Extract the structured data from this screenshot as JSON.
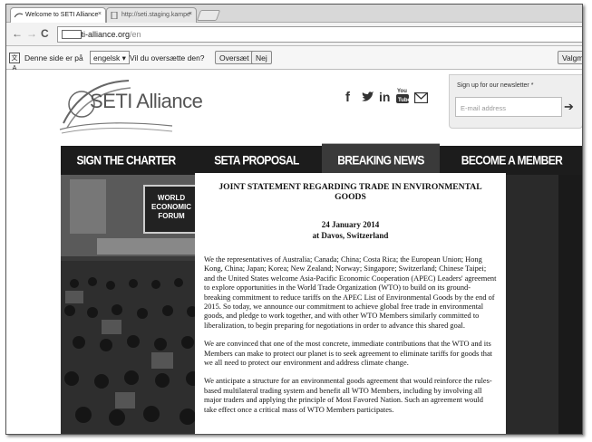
{
  "browser": {
    "tabs": [
      {
        "title": "Welcome to SETI Alliance",
        "close": "×"
      },
      {
        "title": "http://seti.staging.kampe",
        "close": "×"
      }
    ],
    "address": {
      "domain": "seti-alliance.org",
      "path": "/en"
    }
  },
  "translate_bar": {
    "prefix": "Denne side er på",
    "language": "engelsk",
    "question": "Vil du oversætte den?",
    "translate_button": "Oversæt",
    "no_button": "Nej",
    "options_button": "Valgmu"
  },
  "site": {
    "logo_text": "SETI Alliance",
    "newsletter_label": "Sign up for our newsletter *",
    "email_placeholder": "E-mail address",
    "nav": [
      "SIGN THE CHARTER",
      "SETA PROPOSAL",
      "BREAKING NEWS",
      "BECOME A MEMBER"
    ],
    "active_nav": "BREAKING NEWS",
    "photo_sign": [
      "WORLD",
      "ECONOMIC",
      "FORUM"
    ]
  },
  "article": {
    "title": "JOINT STATEMENT REGARDING TRADE IN ENVIRONMENTAL GOODS",
    "date": "24 January 2014",
    "place": "at Davos, Switzerland",
    "paragraphs": [
      "We the representatives of Australia; Canada; China; Costa Rica; the European Union; Hong Kong, China; Japan; Korea; New Zealand; Norway; Singapore; Switzerland; Chinese Taipei; and the United States welcome Asia-Pacific Economic Cooperation (APEC) Leaders' agreement to explore opportunities in the World Trade Organization (WTO) to build on its ground-breaking commitment to reduce tariffs on the APEC List of Environmental Goods by the end of 2015.  So today, we announce our commitment to achieve global free trade in environmental goods, and pledge to work together, and with other WTO Members similarly committed to liberalization, to begin preparing for negotiations in order to advance this shared goal.",
      "We are convinced that one of the most concrete, immediate contributions that the WTO and its Members can make to protect our planet is to seek agreement to eliminate tariffs for goods that we all need to protect our environment and address climate change.",
      "We anticipate a structure for an environmental goods agreement that would reinforce the rules-based multilateral trading system and benefit all WTO Members, including by involving all major traders and applying the principle of Most Favored Nation.  Such an agreement would take effect once a critical mass of WTO Members participates."
    ]
  },
  "icons": [
    "facebook-icon",
    "twitter-icon",
    "linkedin-icon",
    "youtube-icon",
    "mail-icon",
    "arrow-right-icon"
  ]
}
